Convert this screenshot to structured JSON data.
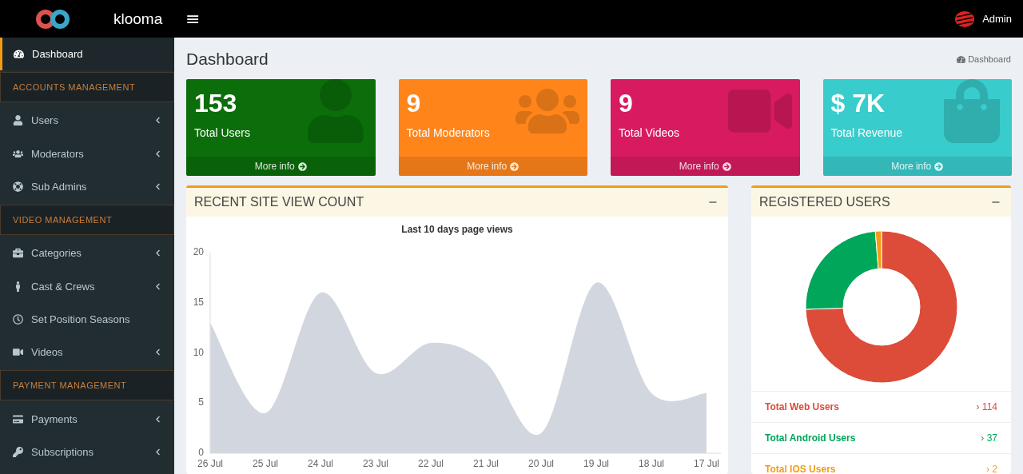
{
  "header": {
    "brand": "klooma",
    "menu_glyph": "≡",
    "user": "Admin"
  },
  "sidebar": {
    "items": [
      {
        "kind": "link",
        "label": "Dashboard",
        "selected": true,
        "has_submenu": false
      },
      {
        "kind": "section",
        "label": "ACCOUNTS MANAGEMENT"
      },
      {
        "kind": "link",
        "label": "Users",
        "selected": false,
        "has_submenu": true
      },
      {
        "kind": "link",
        "label": "Moderators",
        "selected": false,
        "has_submenu": true
      },
      {
        "kind": "link",
        "label": "Sub Admins",
        "selected": false,
        "has_submenu": true
      },
      {
        "kind": "section",
        "label": "VIDEO MANAGEMENT"
      },
      {
        "kind": "link",
        "label": "Categories",
        "selected": false,
        "has_submenu": true
      },
      {
        "kind": "link",
        "label": "Cast & Crews",
        "selected": false,
        "has_submenu": true
      },
      {
        "kind": "link",
        "label": "Set Position Seasons",
        "selected": false,
        "has_submenu": false
      },
      {
        "kind": "link",
        "label": "Videos",
        "selected": false,
        "has_submenu": true
      },
      {
        "kind": "section",
        "label": "PAYMENT MANAGEMENT"
      },
      {
        "kind": "link",
        "label": "Payments",
        "selected": false,
        "has_submenu": true
      },
      {
        "kind": "link",
        "label": "Subscriptions",
        "selected": false,
        "has_submenu": true
      }
    ]
  },
  "page": {
    "title": "Dashboard",
    "breadcrumb": "Dashboard"
  },
  "stat_cards": [
    {
      "value": "153",
      "label": "Total Users",
      "link": "More info",
      "color": "#0b6e0b"
    },
    {
      "value": "9",
      "label": "Total Moderators",
      "link": "More info",
      "color": "#ff851b"
    },
    {
      "value": "9",
      "label": "Total Videos",
      "link": "More info",
      "color": "#d81b60"
    },
    {
      "value": "$ 7K",
      "label": "Total Revenue",
      "link": "More info",
      "color": "#39cccc"
    }
  ],
  "views_panel": {
    "title": "RECENT SITE VIEW COUNT",
    "collapse_glyph": "−",
    "chart_data": {
      "type": "area",
      "title": "Last 10 days page views",
      "categories": [
        "26 Jul",
        "25 Jul",
        "24 Jul",
        "23 Jul",
        "22 Jul",
        "21 Jul",
        "20 Jul",
        "19 Jul",
        "18 Jul",
        "17 Jul"
      ],
      "series": [
        {
          "color": "#d2d6de",
          "values": [
            13,
            4,
            16,
            8,
            11,
            9,
            2,
            17,
            6,
            6
          ]
        }
      ],
      "ylim": [
        0,
        20
      ],
      "yticks": [
        0,
        5,
        10,
        15,
        20
      ]
    }
  },
  "users_panel": {
    "title": "REGISTERED USERS",
    "collapse_glyph": "−",
    "legend": [
      {
        "label": "Total Web Users",
        "arrow_glyph": "›",
        "value": "114",
        "color": "#dd4b39"
      },
      {
        "label": "Total Android Users",
        "arrow_glyph": "›",
        "value": "37",
        "color": "#00a65a"
      },
      {
        "label": "Total IOS Users",
        "arrow_glyph": "›",
        "value": "2",
        "color": "#f39c12"
      }
    ]
  }
}
